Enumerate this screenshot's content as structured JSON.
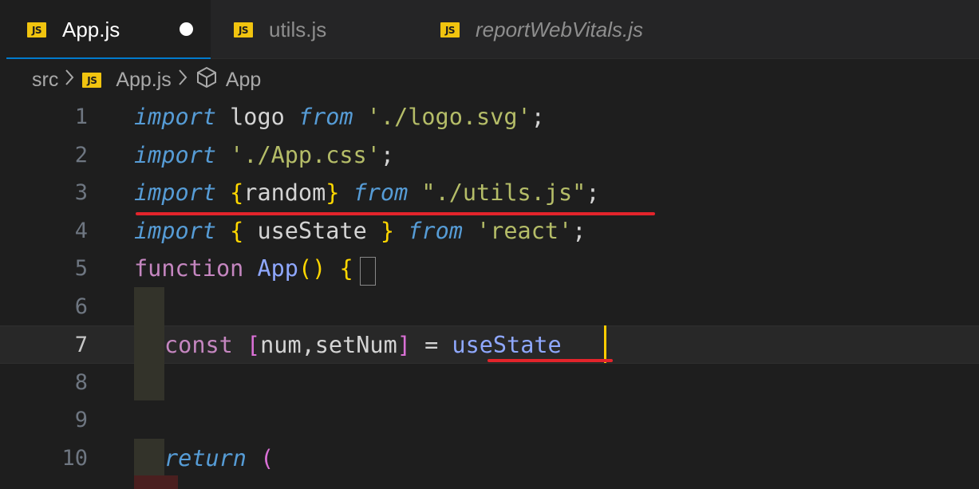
{
  "tabs": [
    {
      "label": "App.js",
      "icon": "js-file-icon",
      "active": true,
      "dirty": true
    },
    {
      "label": "utils.js",
      "icon": "js-file-icon",
      "active": false
    },
    {
      "label": "reportWebVitals.js",
      "icon": "js-file-icon",
      "active": false,
      "italic": true
    }
  ],
  "js_icon_text": "JS",
  "breadcrumb": {
    "folder": "src",
    "file": "App.js",
    "symbol": "App"
  },
  "lines": [
    {
      "number": "1"
    },
    {
      "number": "2"
    },
    {
      "number": "3"
    },
    {
      "number": "4"
    },
    {
      "number": "5"
    },
    {
      "number": "6"
    },
    {
      "number": "7"
    },
    {
      "number": "8"
    },
    {
      "number": "9"
    },
    {
      "number": "10"
    }
  ],
  "code": {
    "l1": {
      "kw": "import",
      "id": "logo",
      "from": "from",
      "str": "'./logo.svg'",
      "semi": ";"
    },
    "l2": {
      "kw": "import",
      "str": "'./App.css'",
      "semi": ";"
    },
    "l3": {
      "kw": "import",
      "open": "{",
      "id": "random",
      "close": "}",
      "from": "from",
      "str": "\"./utils.js\"",
      "semi": ";"
    },
    "l4": {
      "kw": "import",
      "open": "{",
      "id": "useState",
      "close": "}",
      "from": "from",
      "str": "'react'",
      "semi": ";"
    },
    "l5": {
      "kw": "function",
      "name": "App",
      "parens": "()",
      "brace": "{"
    },
    "l7": {
      "kw": "const",
      "lb": "[",
      "ids": "num,setNum",
      "rb": "]",
      "eq": "=",
      "fn": "useState"
    },
    "l10": {
      "kw": "return",
      "paren": "("
    }
  },
  "colors": {
    "accent": "#007acc",
    "error_underline": "#e3242b",
    "cursor": "#ffcc00"
  }
}
